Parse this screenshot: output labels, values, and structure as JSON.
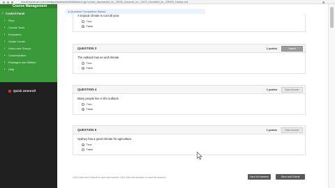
{
  "browser": {
    "url": "bbsu8.blackboard.com/webapps/assessment/take/launch.jsp?course_assessment_id=_29245_1&course_id=_14473_1&content_id=_330000_1&step=null"
  },
  "sidebar": {
    "header": "Course Management",
    "control_panel": "Control Panel",
    "items": [
      {
        "label": "Files"
      },
      {
        "label": "Course Tools"
      },
      {
        "label": "Evaluation"
      },
      {
        "label": "Grade Center"
      },
      {
        "label": "Users and Groups"
      },
      {
        "label": "Customization"
      },
      {
        "label": "Packages and Utilities"
      },
      {
        "label": "Help"
      }
    ],
    "quick_unenroll": "Quick Unenroll"
  },
  "banner": "▸ Question Completion Status:",
  "questions": [
    {
      "text": "A tropical climate is cool all year.",
      "options": [
        "True",
        "False"
      ],
      "selected": 1
    },
    {
      "title": "QUESTION 3",
      "points": "1 points",
      "save_label": "Saved",
      "text": "The outback has an arid climate.",
      "options": [
        "True",
        "False"
      ],
      "selected": 1
    },
    {
      "title": "QUESTION 4",
      "points": "1 points",
      "save_label": "Save Answer",
      "text": "Many people live in the outback.",
      "options": [
        "True",
        "False"
      ],
      "selected": 1
    },
    {
      "title": "QUESTION 5",
      "points": "1 points",
      "save_label": "Save Answer",
      "text": "Sydney has a good climate for agriculture.",
      "options": [
        "True",
        "False"
      ],
      "selected": 0
    }
  ],
  "footer": {
    "note": "Click Save and Submit to save and submit. Click Save All Answers to save all answers.",
    "save_all": "Save All Answers",
    "save_submit": "Save and Submit"
  },
  "colors": {
    "sidebar_green": "#3a9a3a",
    "sidebar_dark": "#1f1f1f",
    "radio_selected": "#2a6fb5",
    "button_dark": "#595959"
  }
}
